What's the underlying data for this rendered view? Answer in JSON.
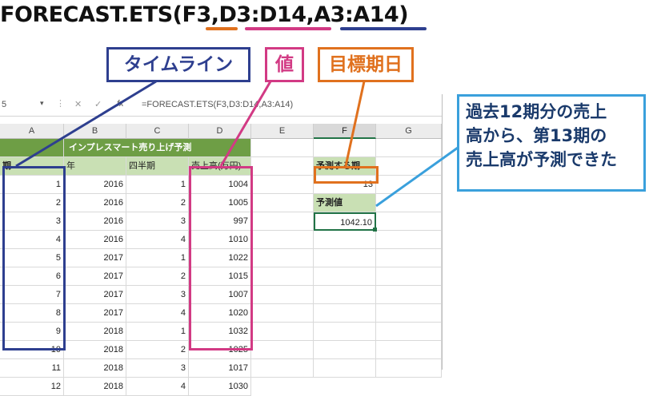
{
  "headline": {
    "func": "FORECAST.ETS(",
    "arg1": "F3",
    "comma1": ",",
    "arg2": "D3:D14",
    "comma2": ",",
    "arg3": "A3:A14",
    "close": ")"
  },
  "labels": {
    "timeline": "タイムライン",
    "value": "値",
    "target": "目標期日",
    "note_line1": "過去12期分の売上",
    "note_line2": "高から、第13期の",
    "note_line3": "売上高が予測できた"
  },
  "formula_bar": {
    "name_box": "5",
    "formula": "=FORECAST.ETS(F3,D3:D14,A3:A14)",
    "cancel_glyph": "✕",
    "enter_glyph": "✓",
    "fx_glyph": "fx"
  },
  "columns": [
    "A",
    "B",
    "C",
    "D",
    "E",
    "F",
    "G"
  ],
  "table": {
    "title": "インプレスマート売り上げ予測",
    "headers": [
      "期",
      "年",
      "四半期",
      "売上高(万円)"
    ],
    "rows": [
      [
        "1",
        "2016",
        "1",
        "1004"
      ],
      [
        "2",
        "2016",
        "2",
        "1005"
      ],
      [
        "3",
        "2016",
        "3",
        "997"
      ],
      [
        "4",
        "2016",
        "4",
        "1010"
      ],
      [
        "5",
        "2017",
        "1",
        "1022"
      ],
      [
        "6",
        "2017",
        "2",
        "1015"
      ],
      [
        "7",
        "2017",
        "3",
        "1007"
      ],
      [
        "8",
        "2017",
        "4",
        "1020"
      ],
      [
        "9",
        "2018",
        "1",
        "1032"
      ],
      [
        "10",
        "2018",
        "2",
        "1025"
      ],
      [
        "11",
        "2018",
        "3",
        "1017"
      ],
      [
        "12",
        "2018",
        "4",
        "1030"
      ]
    ]
  },
  "forecast": {
    "target_label": "予測する期",
    "target_value": "13",
    "result_label": "予測値",
    "result_value": "1042.10"
  },
  "colors": {
    "blue": "#2e3f8f",
    "pink": "#d23a84",
    "orange": "#e0711e",
    "light_blue": "#3aa0dc",
    "excel_green": "#217346"
  }
}
